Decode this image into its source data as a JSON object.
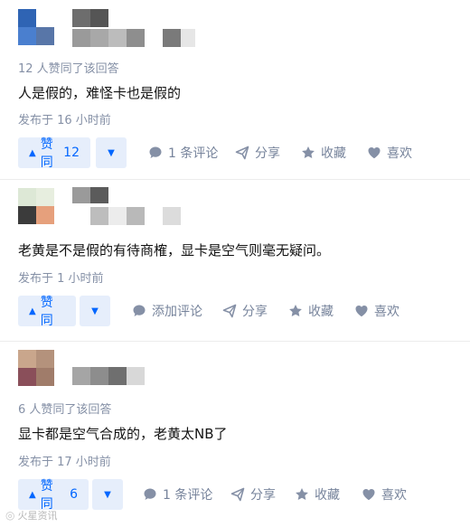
{
  "answers": [
    {
      "voters": "12 人赞同了该回答",
      "content": "人是假的，难怪卡也是假的",
      "time": "发布于 16 小时前",
      "vote_label": "赞同",
      "vote_count": "12",
      "comment_label": "1 条评论",
      "share_label": "分享",
      "fav_label": "收藏",
      "like_label": "喜欢"
    },
    {
      "voters": "",
      "content": "老黄是不是假的有待商榷，显卡是空气则毫无疑问。",
      "time": "发布于 1 小时前",
      "vote_label": "赞同",
      "vote_count": "",
      "comment_label": "添加评论",
      "share_label": "分享",
      "fav_label": "收藏",
      "like_label": "喜欢"
    },
    {
      "voters": "6 人赞同了该回答",
      "content": "显卡都是空气合成的，老黄太NB了",
      "time": "发布于 17 小时前",
      "vote_label": "赞同",
      "vote_count": "6",
      "comment_label": "1 条评论",
      "share_label": "分享",
      "fav_label": "收藏",
      "like_label": "喜欢"
    }
  ],
  "watermark": {
    "text": "火星资讯",
    "icon": "weibo-icon"
  },
  "colors": {
    "accent": "#0066ff",
    "accent_bg": "#e6eefb",
    "meta": "#8590a6",
    "action": "#76839b"
  }
}
